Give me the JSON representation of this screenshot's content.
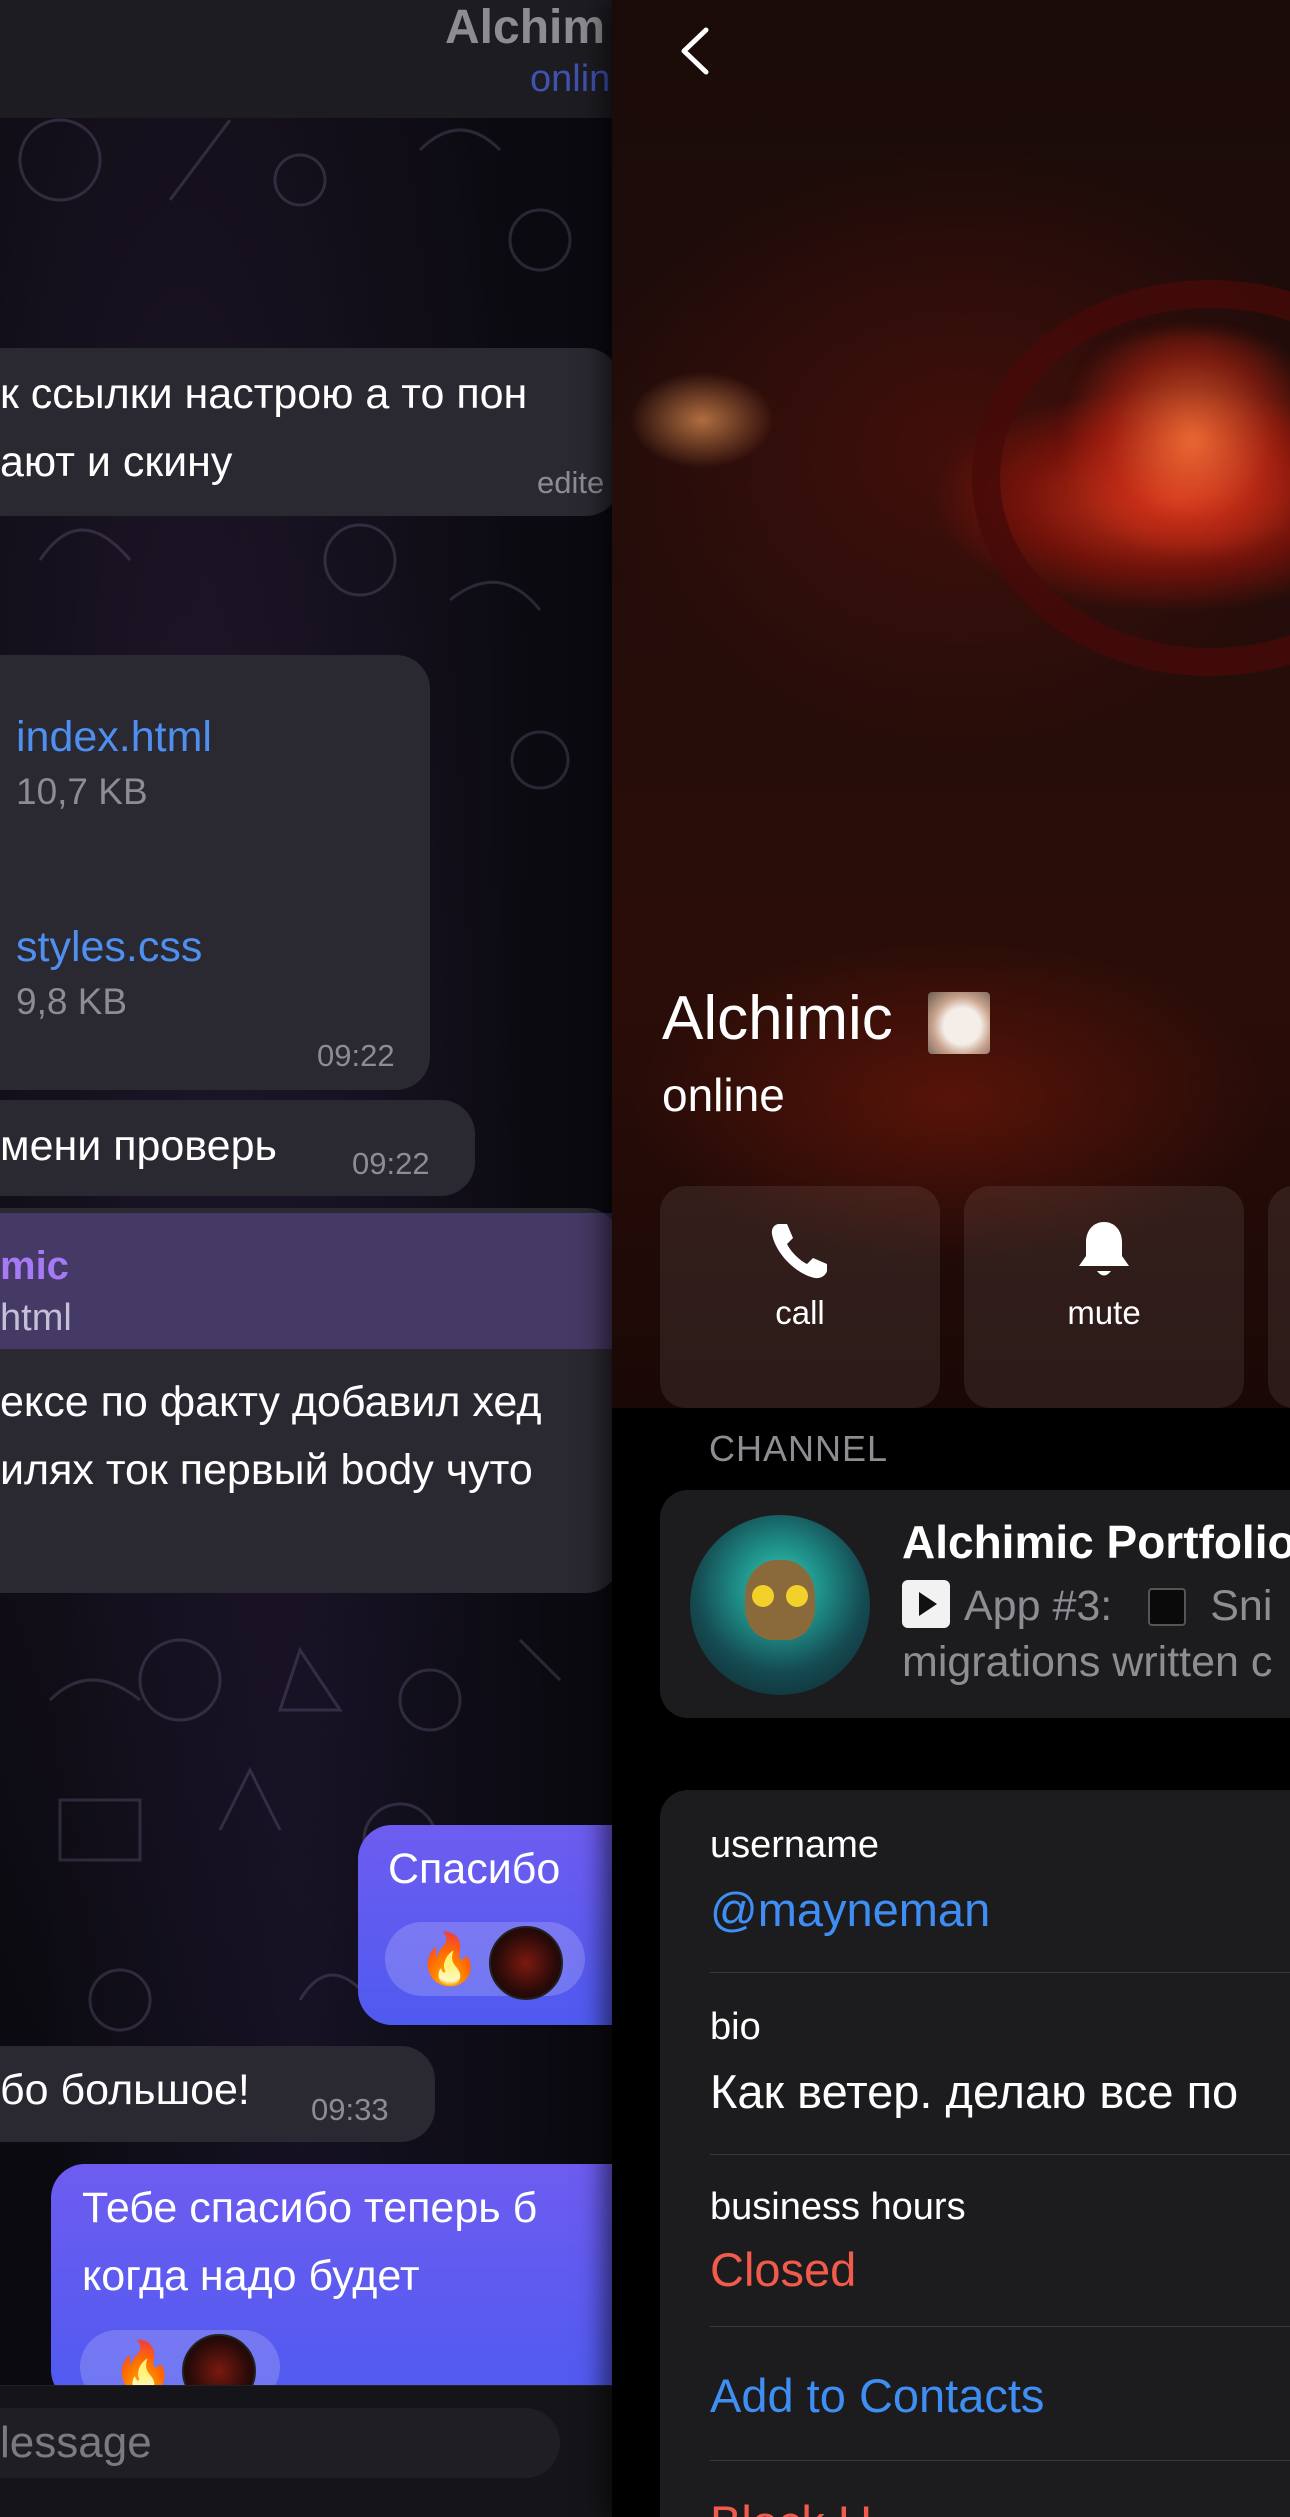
{
  "chat": {
    "header_title": "Alchim",
    "header_status": "onlin",
    "messages": {
      "m1_line1": "к ссылки настрою а то пон",
      "m1_line2": "ают и скину",
      "m1_meta": "edite",
      "file1_name": "index.html",
      "file1_size": "10,7 KB",
      "file2_name": "styles.css",
      "file2_size": "9,8 KB",
      "files_time": "09:22",
      "m2_text": "мени проверь",
      "m2_time": "09:22",
      "reply_name": "mic",
      "reply_text": "html",
      "m3_line1": "ексе по факту добавил хед",
      "m3_line2": "илях ток первый body чуто",
      "out1_text": "Спасибо",
      "m4_text": "бо большое!",
      "m4_time": "09:33",
      "out2_line1": "Тебе спасибо теперь б",
      "out2_line2": "когда надо будет"
    },
    "input_placeholder": "lessage"
  },
  "profile": {
    "name": "Alchimic",
    "status": "online",
    "actions": [
      {
        "label": "call",
        "icon": "phone-icon"
      },
      {
        "label": "mute",
        "icon": "bell-icon"
      }
    ],
    "channel_section_label": "CHANNEL",
    "channel": {
      "title": "Alchimic Portfolio",
      "preview_line1_text": "App #3:",
      "preview_line1_tail": "Sni",
      "preview_line2": "migrations written c"
    },
    "info": {
      "username_label": "username",
      "username_value": "@mayneman",
      "bio_label": "bio",
      "bio_value": "Как ветер. делаю все по",
      "hours_label": "business hours",
      "hours_value": "Closed",
      "add_contacts": "Add to Contacts",
      "block_user": "Block U"
    }
  },
  "colors": {
    "accent_blue": "#3e8ef4",
    "danger_red": "#f25b4b",
    "outgoing_bubble": "#5b5bf0",
    "card_bg": "#1c1c1e"
  }
}
